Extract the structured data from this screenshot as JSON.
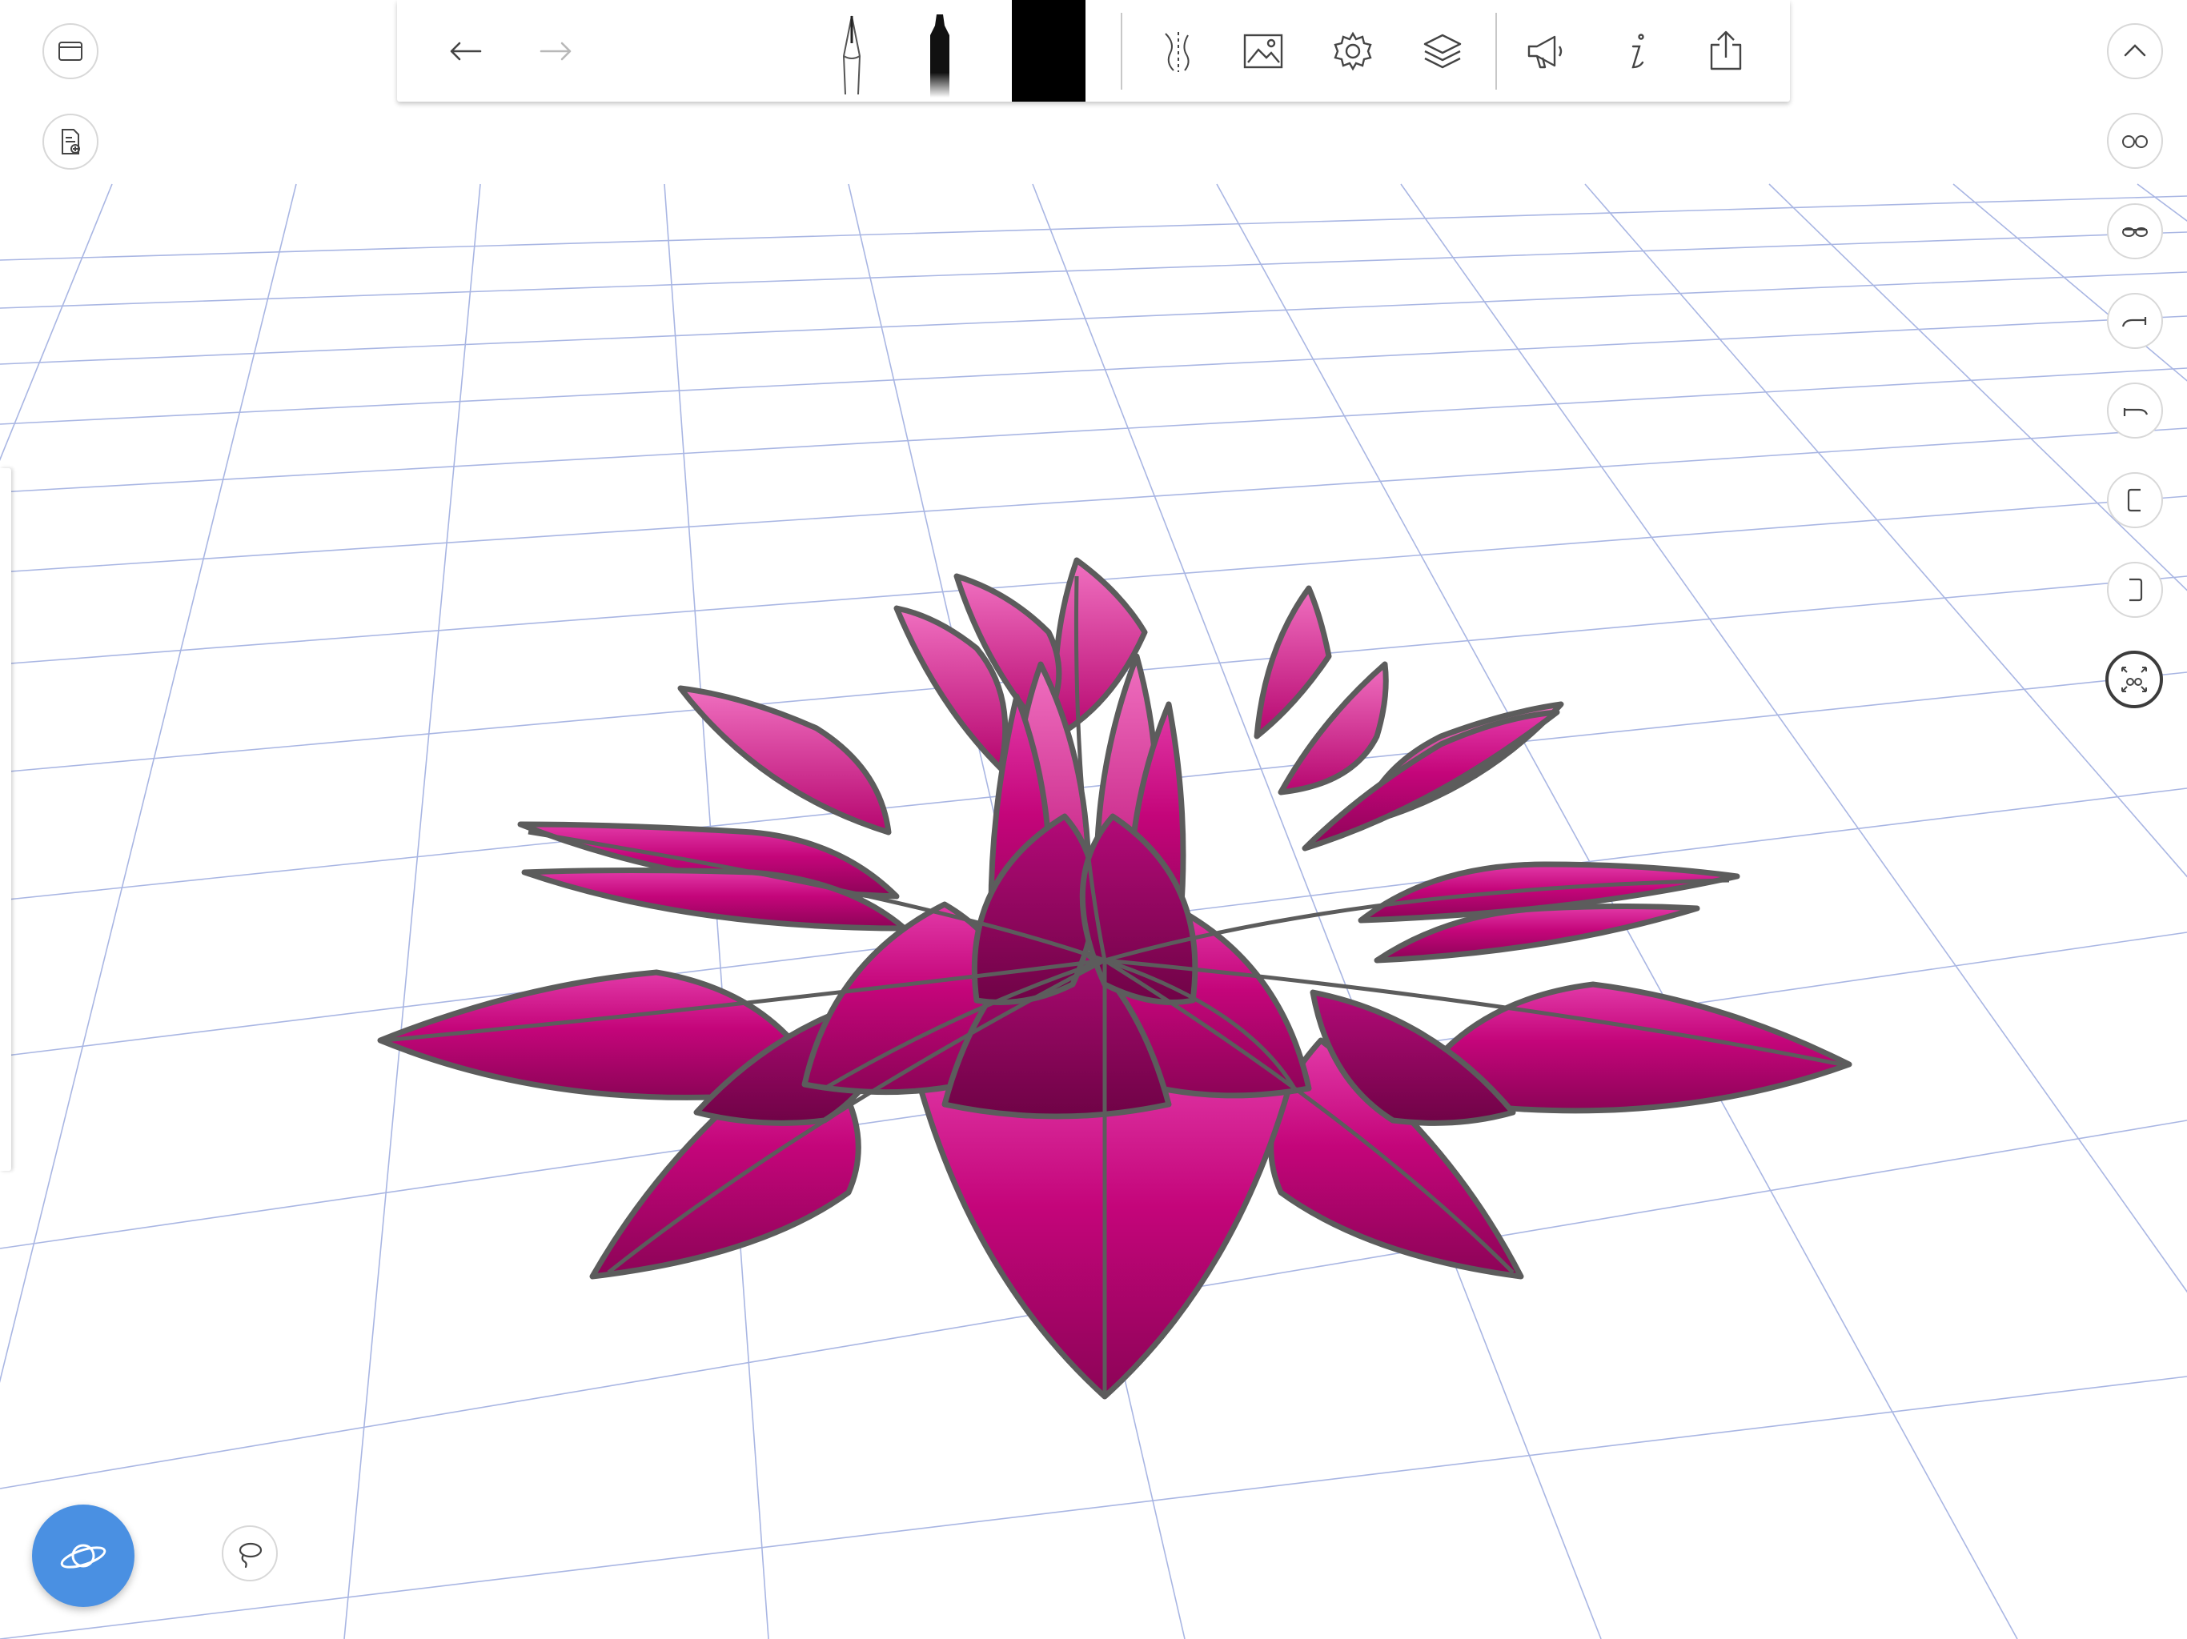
{
  "app": {
    "accent_color": "#4a90e2",
    "petal_color": "#c4057a",
    "petal_outline_color": "#5a5a5a",
    "grid_color": "#9fb0e0"
  },
  "toolbar": {
    "undo_icon": "undo-arrow-icon",
    "redo_icon": "redo-arrow-icon",
    "tools": [
      "pencil-icon",
      "marker-icon"
    ],
    "current_color": "#000000",
    "actions": [
      "symmetry-icon",
      "image-icon",
      "settings-gear-icon",
      "layers-icon",
      "announcement-megaphone-icon",
      "info-icon",
      "share-export-icon"
    ]
  },
  "left_controls": [
    "window-icon",
    "document-add-icon"
  ],
  "right_controls": [
    "collapse-chevron-up-icon",
    "view-front-glasses-icon",
    "view-top-glasses-icon",
    "view-side-left-icon",
    "view-side-right-icon",
    "bracket-left-icon",
    "bracket-right-icon",
    "fit-to-screen-icon"
  ],
  "bottom_controls": [
    "orbit-planet-icon",
    "lasso-icon"
  ]
}
